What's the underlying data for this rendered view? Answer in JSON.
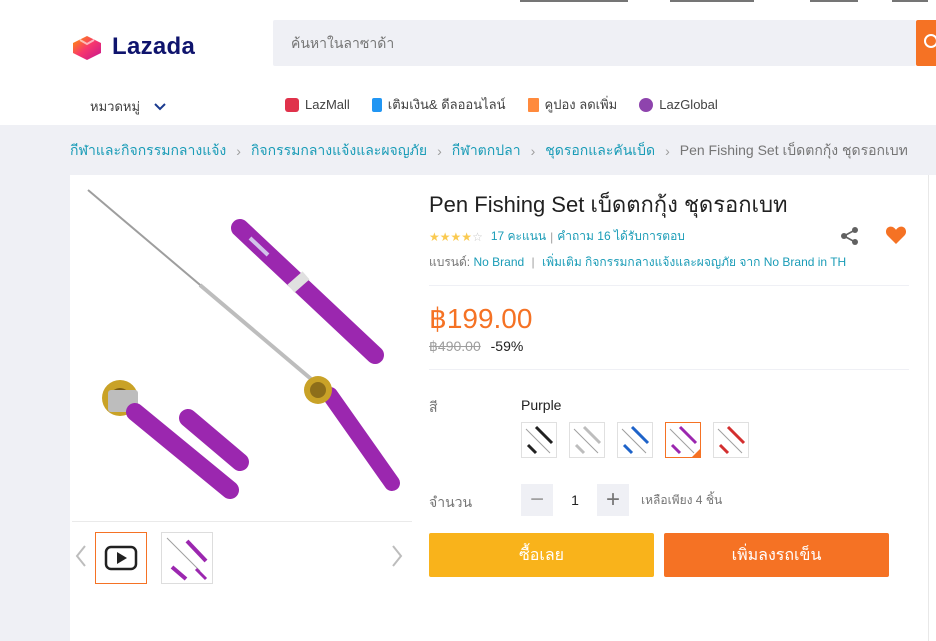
{
  "header": {
    "brand_name": "Lazada",
    "search_placeholder": "ค้นหาในลาซาด้า",
    "categories_label": "หมวดหมู่",
    "nav_links": [
      {
        "label": "LazMall",
        "icon": "lazmall-icon"
      },
      {
        "label": "เติมเงิน& ดีลออนไลน์",
        "icon": "topup-phone-icon"
      },
      {
        "label": "คูปอง ลดเพิ่ม",
        "icon": "coupon-icon"
      },
      {
        "label": "LazGlobal",
        "icon": "lazglobal-icon"
      }
    ]
  },
  "breadcrumb": {
    "items": [
      "กีฬาและกิจกรรมกลางแจ้ง",
      "กิจกรรมกลางแจ้งและผจญภัย",
      "กีฬาตกปลา",
      "ชุดรอกและคันเบ็ด"
    ],
    "current": "Pen Fishing Set เบ็ดตกกุ้ง ชุดรอกเบท"
  },
  "product": {
    "title": "Pen Fishing Set เบ็ดตกกุ้ง ชุดรอกเบท",
    "rating_stars": 3.5,
    "ratings_text": "17 คะแนน",
    "questions_text": "คำถาม 16 ได้รับการตอบ",
    "brand_label": "แบรนด์:",
    "brand_value": "No Brand",
    "more_from_brand": "เพิ่มเติม กิจกรรมกลางแจ้งและผจญภัย จาก No Brand in TH",
    "price": "฿199.00",
    "original_price": "฿490.00",
    "discount": "-59%",
    "color_label": "สี",
    "color_selected": "Purple",
    "color_options": [
      "Black",
      "Silver",
      "Blue",
      "Purple",
      "Red"
    ],
    "quantity_label": "จำนวน",
    "quantity_value": "1",
    "stock_text": "เหลือเพียง 4 ชิ้น",
    "buy_now_label": "ซื้อเลย",
    "add_to_cart_label": "เพิ่มลงรถเข็น"
  },
  "colors": {
    "brand_orange": "#f57224",
    "buy_yellow": "#f9b31b",
    "link_blue": "#1a9cb7",
    "product_purple": "#9b27af"
  }
}
